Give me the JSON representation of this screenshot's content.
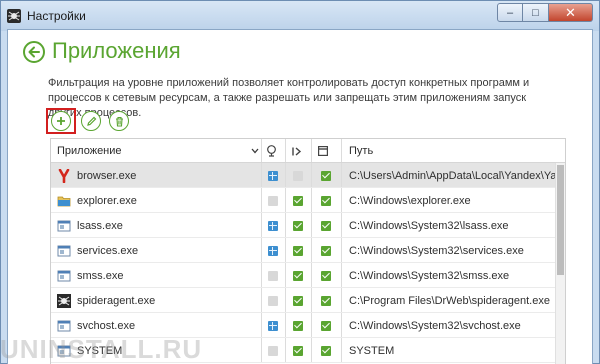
{
  "window": {
    "title": "Настройки",
    "controls": {
      "minimize": "–",
      "maximize": "□",
      "close": "✕"
    }
  },
  "page": {
    "title": "Приложения",
    "description": "Фильтрация на уровне приложений позволяет контролировать доступ конкретных программ и процессов к сетевым ресурсам, а также разрешать или запрещать этим приложениям запуск других процессов."
  },
  "toolbar": {
    "add_icon": "plus-icon",
    "edit_icon": "pencil-icon",
    "delete_icon": "trash-icon",
    "selected": "add"
  },
  "table": {
    "headers": {
      "app": "Приложение",
      "path": "Путь"
    },
    "rows": [
      {
        "name": "browser.exe",
        "icon": "yandex-browser-icon",
        "net": "on-net",
        "c2": "off",
        "c3": "on",
        "path": "C:\\Users\\Admin\\AppData\\Local\\Yandex\\Yand...",
        "selected": true
      },
      {
        "name": "explorer.exe",
        "icon": "folder-icon",
        "net": "off",
        "c2": "on",
        "c3": "on",
        "path": "C:\\Windows\\explorer.exe",
        "selected": false
      },
      {
        "name": "lsass.exe",
        "icon": "window-icon",
        "net": "on-net",
        "c2": "on",
        "c3": "on",
        "path": "C:\\Windows\\System32\\lsass.exe",
        "selected": false
      },
      {
        "name": "services.exe",
        "icon": "window-icon",
        "net": "on-net",
        "c2": "on",
        "c3": "on",
        "path": "C:\\Windows\\System32\\services.exe",
        "selected": false
      },
      {
        "name": "smss.exe",
        "icon": "window-icon",
        "net": "off",
        "c2": "on",
        "c3": "on",
        "path": "C:\\Windows\\System32\\smss.exe",
        "selected": false
      },
      {
        "name": "spideragent.exe",
        "icon": "spider-icon",
        "net": "off",
        "c2": "on",
        "c3": "on",
        "path": "C:\\Program Files\\DrWeb\\spideragent.exe",
        "selected": false
      },
      {
        "name": "svchost.exe",
        "icon": "window-icon",
        "net": "on-net",
        "c2": "on",
        "c3": "on",
        "path": "C:\\Windows\\System32\\svchost.exe",
        "selected": false
      },
      {
        "name": "SYSTEM",
        "icon": "window-icon",
        "net": "off",
        "c2": "on",
        "c3": "on",
        "path": "SYSTEM",
        "selected": false
      }
    ]
  },
  "watermark": "UNINSTALL.RU",
  "colors": {
    "accent": "#5aa531",
    "selection_outline": "#d21f1f",
    "net_blue": "#3d8fd0"
  }
}
